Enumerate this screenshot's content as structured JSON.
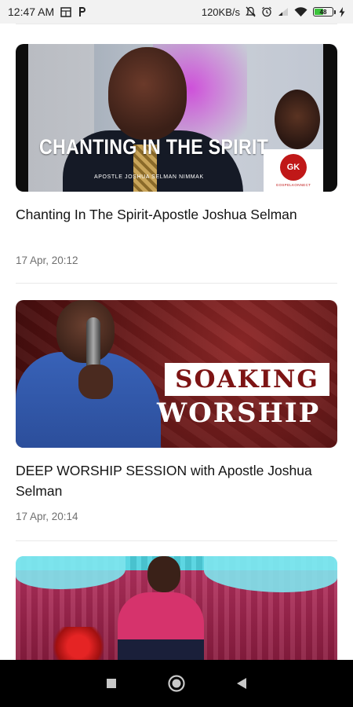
{
  "status_bar": {
    "time": "12:47 AM",
    "network_speed": "120KB/s",
    "battery": "48",
    "battery_level": 0.48,
    "icons": [
      "screen-icon",
      "p-icon",
      "mute-icon",
      "alarm-icon",
      "signal-icon",
      "wifi-icon",
      "battery-icon",
      "charging-icon"
    ]
  },
  "feed": {
    "items": [
      {
        "thumbnail_title": "CHANTING IN THE SPIRIT",
        "thumbnail_subtitle": "APOSTLE JOSHUA SELMAN NIMMAK",
        "thumbnail_logo": "GK",
        "thumbnail_logo_text": "GOSPELKONNECT",
        "title": "Chanting In The Spirit-Apostle Joshua Selman",
        "date": "17 Apr, 20:12"
      },
      {
        "thumbnail_line1": "SOAKING",
        "thumbnail_line2": "WORSHIP",
        "title": "DEEP WORSHIP SESSION with Apostle Joshua Selman",
        "date": "17 Apr, 20:14"
      },
      {
        "title": "",
        "date": ""
      }
    ]
  },
  "nav_bar": {
    "buttons": [
      "recents",
      "home",
      "back"
    ]
  }
}
